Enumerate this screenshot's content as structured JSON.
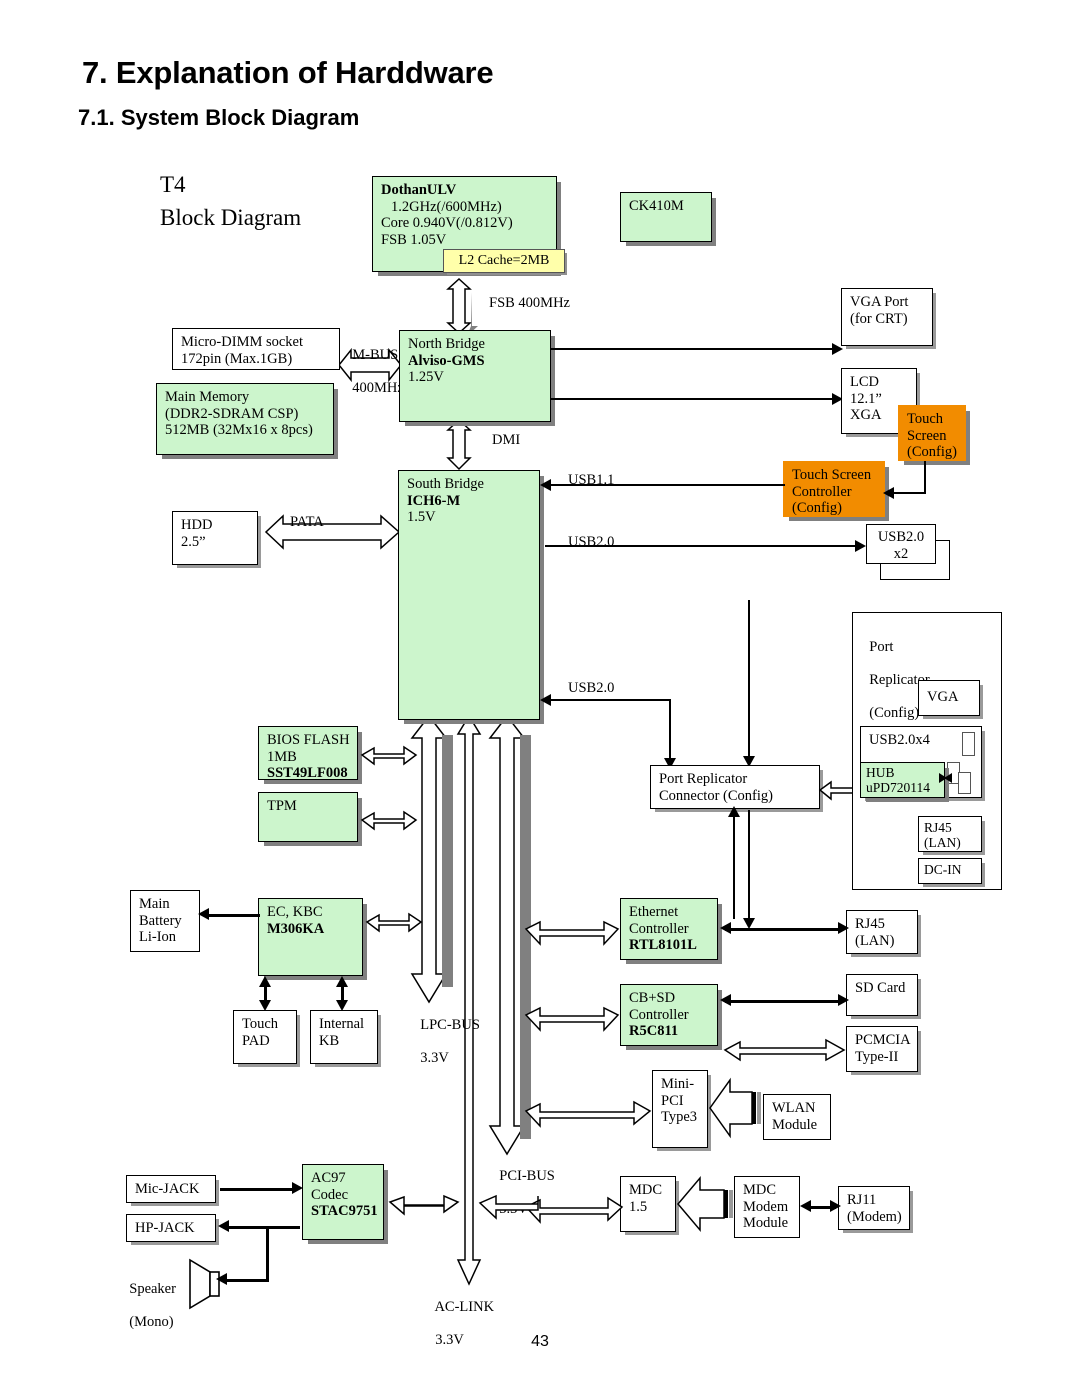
{
  "document": {
    "title": "7. Explanation of Harddware",
    "section": "7.1. System Block Diagram",
    "section_number": "7.1.",
    "section_name": "System Block Diagram",
    "page_number": "43",
    "diagram_title_line1": "T4",
    "diagram_title_line2": "Block Diagram"
  },
  "colors": {
    "chip_green": "#ccf5cc",
    "config_orange": "#f28c00",
    "cache_yellow": "#ffffaa",
    "shadow_grey": "#808080",
    "line_black": "#000000"
  },
  "blocks": {
    "cpu": {
      "name": "DothanULV",
      "l1": "1.2GHz(/600MHz)",
      "l2": "Core 0.940V(/0.812V)",
      "l3": "FSB 1.05V",
      "cache": "L2 Cache=2MB"
    },
    "clock": {
      "name": "CK410M"
    },
    "dimm": {
      "l1": "Micro-DIMM socket",
      "l2": "172pin (Max.1GB)"
    },
    "main_memory": {
      "l1": "Main Memory",
      "l2": "(DDR2-SDRAM CSP)",
      "l3": "512MB (32Mx16 x 8pcs)"
    },
    "north_bridge": {
      "l1": "North Bridge",
      "l2": "Alviso-GMS",
      "l3": "1.25V"
    },
    "south_bridge": {
      "l1": "South Bridge",
      "l2": "ICH6-M",
      "l3": "1.5V"
    },
    "vga_port": {
      "l1": "VGA Port",
      "l2": "(for CRT)"
    },
    "lcd": {
      "l1": "LCD",
      "l2": "12.1”",
      "l3": "XGA"
    },
    "touch_screen": {
      "l1": "Touch",
      "l2": "Screen",
      "l3": "(Config)"
    },
    "touch_screen_controller": {
      "l1": "Touch Screen",
      "l2": "Controller",
      "l3": "(Config)"
    },
    "usb2_x2": {
      "l1": "USB2.0",
      "l2": "x2"
    },
    "hdd": {
      "l1": "HDD",
      "l2": "2.5”"
    },
    "bios_flash": {
      "l1": "BIOS FLASH",
      "l2": "1MB",
      "l3": "SST49LF008"
    },
    "tpm": {
      "l1": "TPM"
    },
    "ec_kbc": {
      "l1": "EC, KBC",
      "l2": "M306KA"
    },
    "main_battery": {
      "l1": "Main",
      "l2": "Battery",
      "l3": "Li-Ion"
    },
    "touch_pad": {
      "l1": "Touch",
      "l2": "PAD"
    },
    "internal_kb": {
      "l1": "Internal",
      "l2": "KB"
    },
    "port_replicator_connector": {
      "l1": "Port    Replicator",
      "l2": "Connector (Config)"
    },
    "port_replicator": {
      "l1": "Port",
      "l2": "Replicator",
      "l3": "(Config)"
    },
    "pr_vga": {
      "l1": "VGA"
    },
    "pr_usb": {
      "l1": "USB2.0x4"
    },
    "pr_hub": {
      "l1": "HUB",
      "l2": "uPD720114"
    },
    "pr_rj45": {
      "l1": "RJ45",
      "l2": "(LAN)"
    },
    "pr_dcin": {
      "l1": "DC-IN"
    },
    "ethernet_controller": {
      "l1": "Ethernet",
      "l2": "Controller",
      "l3": "RTL8101L"
    },
    "rj45_lan": {
      "l1": "RJ45",
      "l2": "(LAN)"
    },
    "cbsd_controller": {
      "l1": "CB+SD",
      "l2": "Controller",
      "l3": "R5C811"
    },
    "sd_card": {
      "l1": "SD Card"
    },
    "pcmcia": {
      "l1": "PCMCIA",
      "l2": "Type-II"
    },
    "mini_pci": {
      "l1": "Mini-",
      "l2": "PCI",
      "l3": "Type3"
    },
    "wlan_module": {
      "l1": "WLAN",
      "l2": "Module"
    },
    "mdc": {
      "l1": "MDC",
      "l2": "1.5"
    },
    "mdc_modem_module": {
      "l1": "MDC",
      "l2": "Modem",
      "l3": "Module"
    },
    "rj11": {
      "l1": "RJ11",
      "l2": "(Modem)"
    },
    "ac97_codec": {
      "l1": "AC97",
      "l2": "Codec",
      "l3": "STAC9751"
    },
    "mic_jack": {
      "l1": "Mic-JACK"
    },
    "hp_jack": {
      "l1": "HP-JACK"
    },
    "speaker": {
      "l1": "Speaker",
      "l2": "(Mono)"
    }
  },
  "bus_labels": {
    "fsb": "FSB 400MHz",
    "mbus_l1": "M-BUS",
    "mbus_l2": "400MHz",
    "dmi": "DMI",
    "pata": "PATA",
    "usb11": "USB1.1",
    "usb20_a": "USB2.0",
    "usb20_b": "USB2.0",
    "lpc_l1": "LPC-BUS",
    "lpc_l2": "3.3V",
    "pci_l1": "PCI-BUS",
    "pci_l2": "3.3V",
    "aclink_l1": "AC-LINK",
    "aclink_l2": "3.3V"
  }
}
